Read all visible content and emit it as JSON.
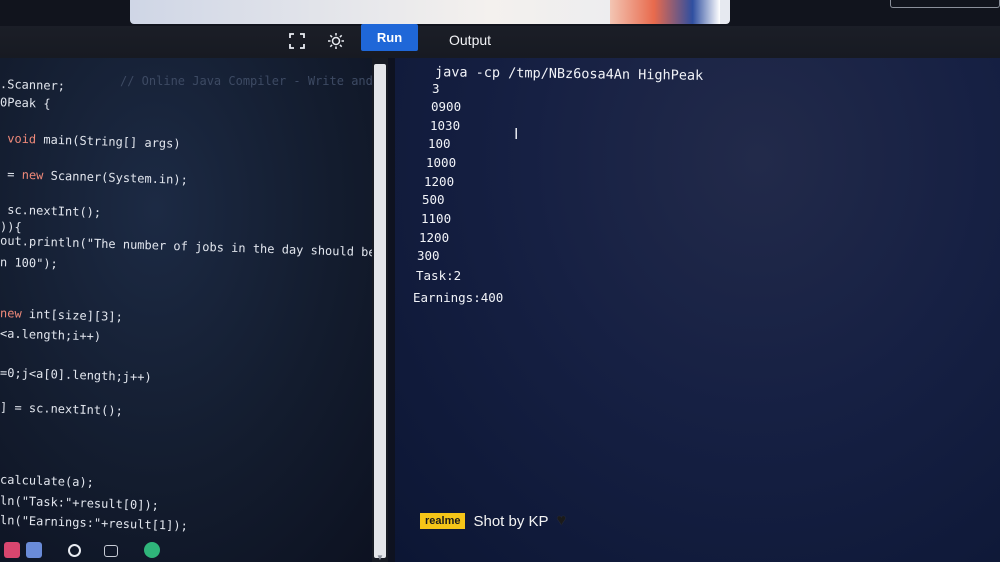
{
  "toolbar": {
    "fullscreen_icon": "fullscreen-icon",
    "theme_icon": "theme-toggle-icon",
    "run_label": "Run",
    "output_title": "Output"
  },
  "editor": {
    "lines": [
      ".Scanner;",
      "0Peak {",
      " void main(String[] args)",
      " = new Scanner(System.in);",
      " sc.nextInt();",
      ")){",
      "out.println(\"The number of jobs in the day should be less",
      "n 100\");",
      "new int[size][3];",
      "<a.length;i++)",
      "=0;j<a[0].length;j++)",
      "] = sc.nextInt();",
      "calculate(a);",
      "ln(\"Task:\"+result[0]);",
      "ln(\"Earnings:\"+result[1]);"
    ],
    "faded_hint": "// Online Java Compiler - Write and run your Java code online"
  },
  "output": {
    "command": "java -cp /tmp/NBz6osa4An HighPeak",
    "lines": [
      "3",
      "0900",
      "1030",
      "100",
      "1000",
      "1200",
      "500",
      "1100",
      "1200",
      "300",
      "Task:2",
      "Earnings:400"
    ]
  },
  "watermark": {
    "brand": "realme",
    "text": "Shot by KP"
  },
  "colors": {
    "run_button": "#1f67d8",
    "output_bg": "#162043",
    "editor_bg": "#131c2e",
    "keyword": "#f08a7a",
    "watermark_brand": "#f5c518"
  }
}
